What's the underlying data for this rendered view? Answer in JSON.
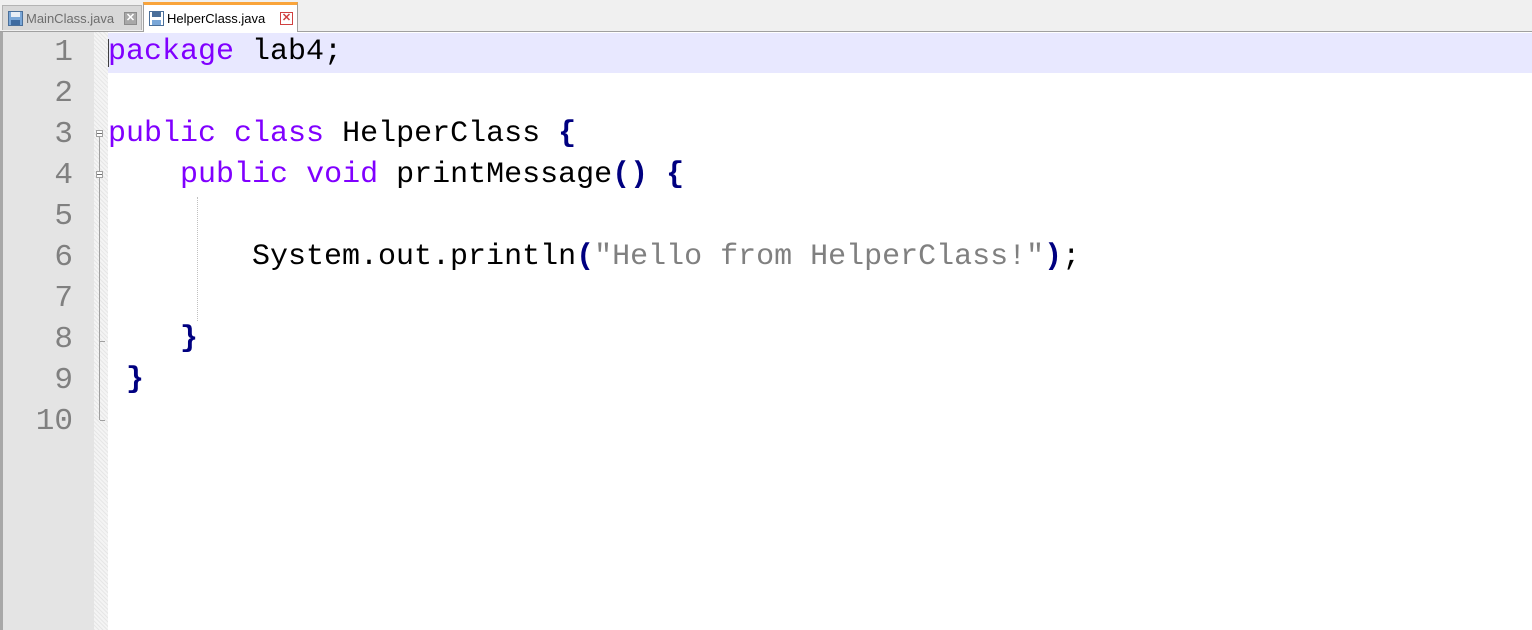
{
  "tabs": [
    {
      "label": "MainClass.java",
      "active": false
    },
    {
      "label": "HelperClass.java",
      "active": true
    }
  ],
  "colors": {
    "keyword": "#8000ff",
    "brace": "#000080",
    "string": "#808080",
    "current_line_highlight": "#e8e8ff",
    "active_tab_accent": "#f9a43b"
  },
  "editor": {
    "current_line": 1,
    "line_numbers": [
      "1",
      "2",
      "3",
      "4",
      "5",
      "6",
      "7",
      "8",
      "9",
      "10"
    ],
    "lines": [
      {
        "tokens": [
          {
            "t": "package",
            "c": "kw"
          },
          {
            "t": " lab4;",
            "c": ""
          }
        ]
      },
      {
        "tokens": []
      },
      {
        "tokens": [
          {
            "t": "public",
            "c": "kw"
          },
          {
            "t": " ",
            "c": ""
          },
          {
            "t": "class",
            "c": "kw"
          },
          {
            "t": " HelperClass ",
            "c": ""
          },
          {
            "t": "{",
            "c": "brace"
          }
        ]
      },
      {
        "tokens": [
          {
            "t": "    ",
            "c": ""
          },
          {
            "t": "public",
            "c": "kw"
          },
          {
            "t": " ",
            "c": ""
          },
          {
            "t": "void",
            "c": "kw"
          },
          {
            "t": " printMessage",
            "c": ""
          },
          {
            "t": "()",
            "c": "brace"
          },
          {
            "t": " ",
            "c": ""
          },
          {
            "t": "{",
            "c": "brace"
          }
        ]
      },
      {
        "tokens": []
      },
      {
        "tokens": [
          {
            "t": "        System.out.println",
            "c": ""
          },
          {
            "t": "(",
            "c": "brace"
          },
          {
            "t": "\"Hello from HelperClass!\"",
            "c": "str"
          },
          {
            "t": ")",
            "c": "brace"
          },
          {
            "t": ";",
            "c": ""
          }
        ]
      },
      {
        "tokens": []
      },
      {
        "tokens": [
          {
            "t": "    ",
            "c": ""
          },
          {
            "t": "}",
            "c": "brace"
          }
        ]
      },
      {
        "tokens": [
          {
            "t": " ",
            "c": ""
          },
          {
            "t": "}",
            "c": "brace"
          }
        ]
      },
      {
        "tokens": []
      }
    ]
  }
}
